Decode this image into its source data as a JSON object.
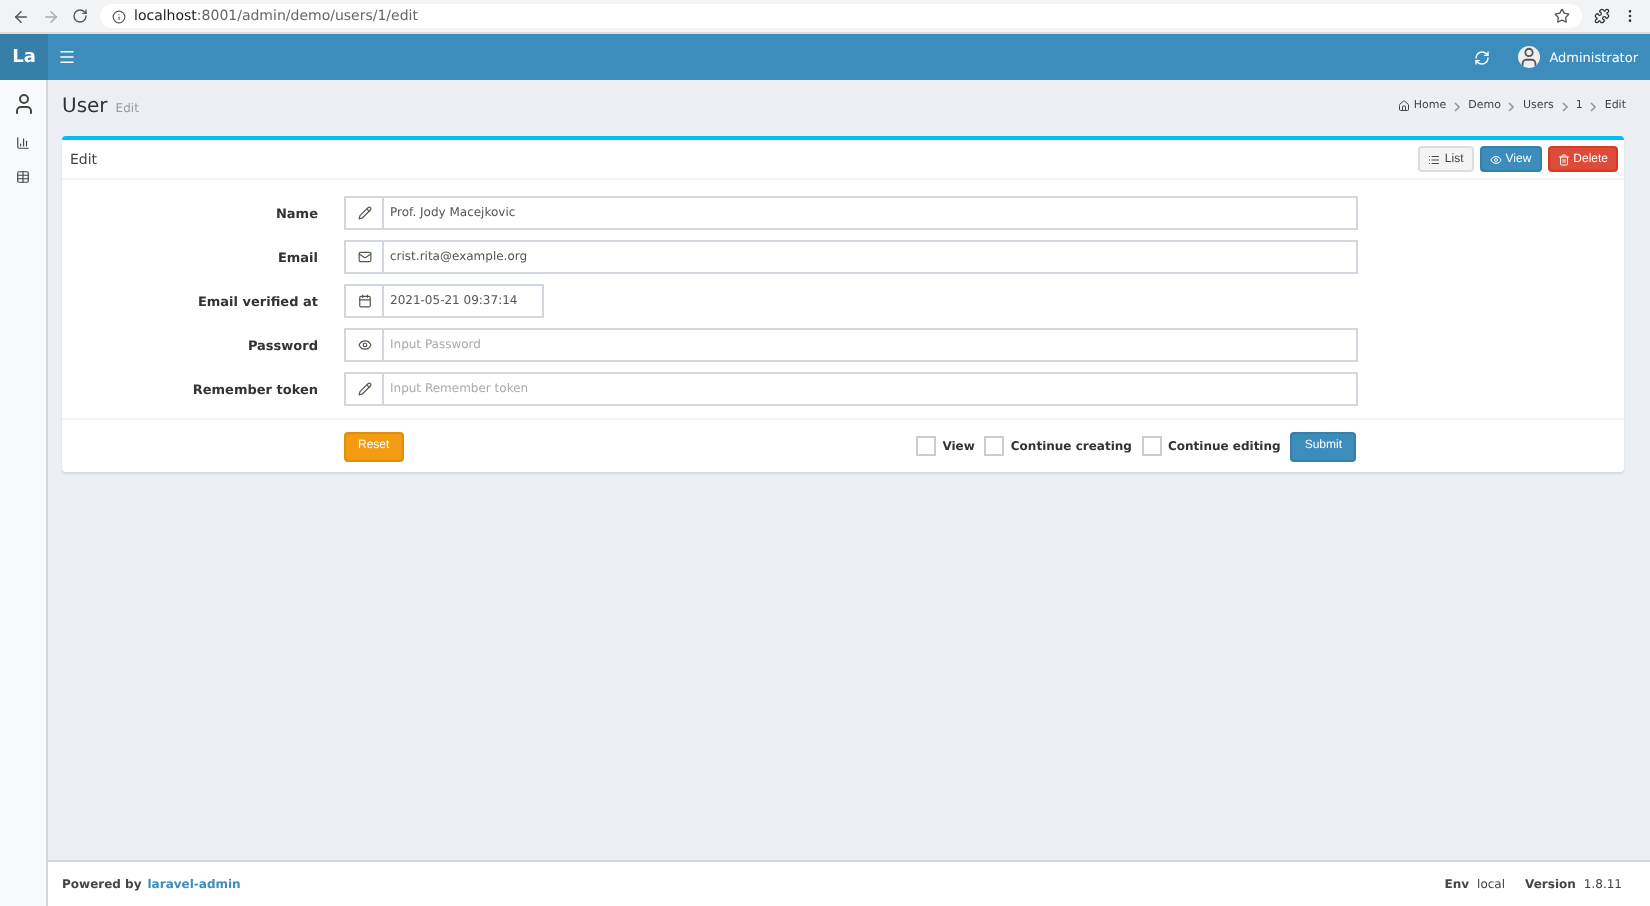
{
  "browser": {
    "url_host": "localhost",
    "url_path": ":8001/admin/demo/users/1/edit"
  },
  "header": {
    "logo": "La",
    "user": "Administrator"
  },
  "page": {
    "title": "User",
    "subtitle": "Edit"
  },
  "breadcrumb": [
    "Home",
    "Demo",
    "Users",
    "1",
    "Edit"
  ],
  "box": {
    "title": "Edit",
    "tools": [
      {
        "kind": "list",
        "label": "List"
      },
      {
        "kind": "view",
        "label": "View"
      },
      {
        "kind": "delete",
        "label": "Delete"
      }
    ]
  },
  "fields": [
    {
      "label": "Name",
      "kind": "text",
      "value": "Prof. Jody Macejkovic"
    },
    {
      "label": "Email",
      "kind": "email",
      "value": "crist.rita@example.org"
    },
    {
      "label": "Email verified at",
      "kind": "datetime",
      "value": "2021-05-21 09:37:14"
    },
    {
      "label": "Password",
      "kind": "password",
      "placeholder": "Input Password"
    },
    {
      "label": "Remember token",
      "kind": "text",
      "placeholder": "Input Remember token"
    }
  ],
  "reset": "Reset",
  "options": [
    {
      "label": "View",
      "checked": false
    },
    {
      "label": "Continue creating",
      "checked": false
    },
    {
      "label": "Continue editing",
      "checked": false
    }
  ],
  "submit": "Submit",
  "footer": {
    "powered": "Powered by",
    "link": "laravel-admin",
    "env_label": "Env",
    "env": "local",
    "version_label": "Version",
    "version": "1.8.11"
  }
}
